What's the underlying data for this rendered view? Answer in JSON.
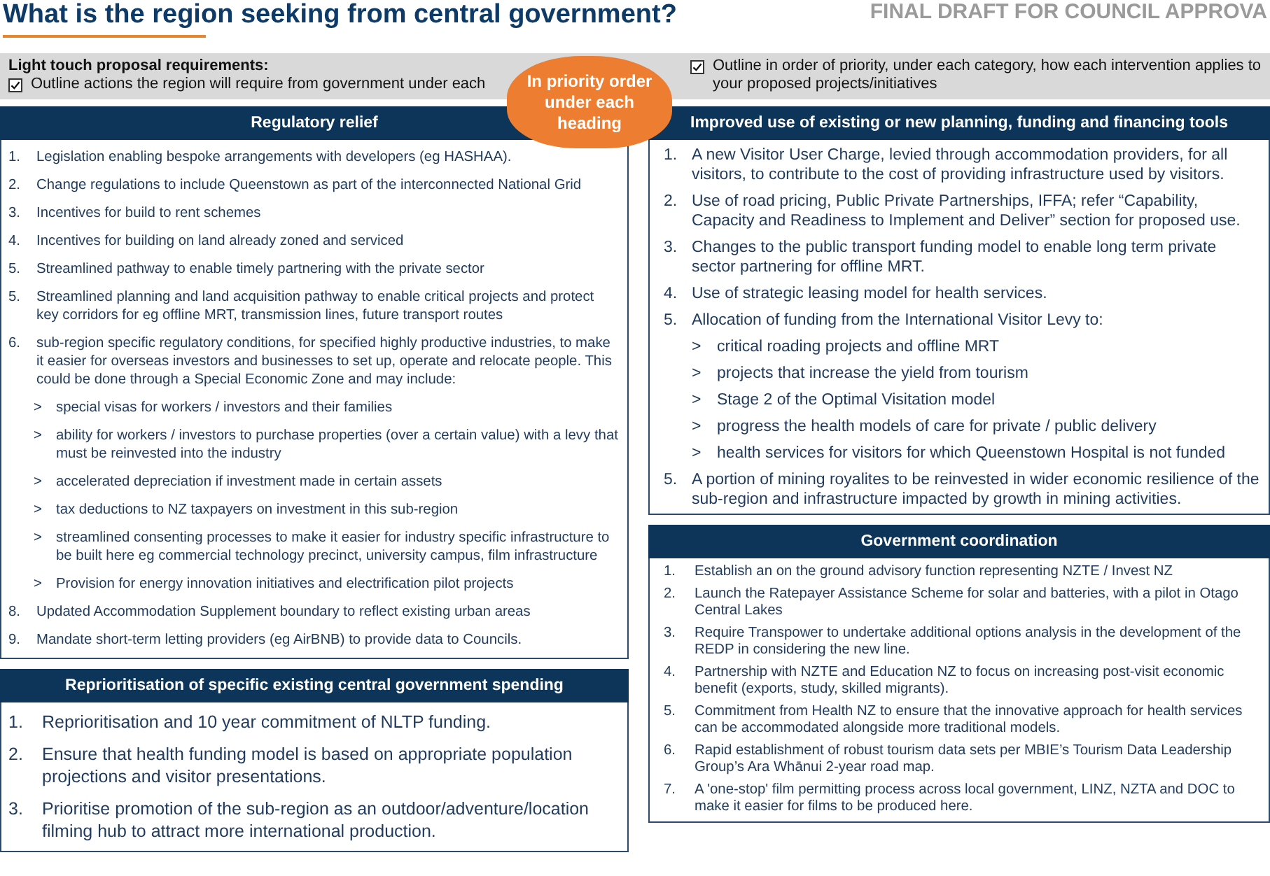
{
  "title": "What is the region seeking from central government?",
  "draft_label": "FINAL DRAFT FOR COUNCIL APPROVA",
  "requirements": {
    "heading": "Light touch proposal requirements:",
    "items": [
      {
        "checked": true,
        "text": "Outline actions the region will require from government under each"
      },
      {
        "checked": true,
        "text": "Outline in order of priority, under each category, how each intervention applies to your proposed projects/initiatives"
      }
    ]
  },
  "callout": "In priority order under each heading",
  "columns": [
    {
      "sections": [
        {
          "heading": "Regulatory relief",
          "items": [
            {
              "number": "1.",
              "text": "Legislation enabling bespoke arrangements with developers (eg HASHAA)."
            },
            {
              "number": "2.",
              "text": "Change regulations to include Queenstown as part of the interconnected National Grid"
            },
            {
              "number": "3.",
              "text": "Incentives for build to rent schemes"
            },
            {
              "number": "4.",
              "text": "Incentives for building on land already zoned and serviced"
            },
            {
              "number": "5.",
              "text": "Streamlined pathway to enable timely partnering with the private sector"
            },
            {
              "number": "5.",
              "text": "Streamlined planning and land acquisition pathway to enable critical projects and protect key corridors for eg offline MRT, transmission lines, future transport routes"
            },
            {
              "number": "6.",
              "text": "sub-region specific regulatory conditions, for specified highly productive industries, to make it easier for overseas investors and businesses to set up, operate and relocate people. This could be done through a Special Economic Zone and may include:",
              "children": [
                {
                  "marker": ">",
                  "text": "special visas for workers / investors and their families"
                },
                {
                  "marker": ">",
                  "text": "ability for workers / investors to purchase properties (over a certain value) with a levy that must be reinvested into the industry"
                },
                {
                  "marker": ">",
                  "text": "accelerated depreciation if investment made in certain assets"
                },
                {
                  "marker": ">",
                  "text": "tax deductions to NZ taxpayers on investment in this sub-region"
                },
                {
                  "marker": ">",
                  "text": "streamlined consenting processes to make it easier for industry specific infrastructure to be built here eg commercial technology precinct, university campus, film infrastructure"
                },
                {
                  "marker": ">",
                  "text": "Provision for energy innovation initiatives and electrification pilot projects"
                }
              ]
            },
            {
              "number": "8.",
              "text": "Updated Accommodation Supplement boundary to reflect existing urban areas"
            },
            {
              "number": "9.",
              "text": "Mandate short-term letting providers (eg AirBNB) to provide data to Councils."
            }
          ]
        },
        {
          "heading": "Reprioritisation of specific existing central government spending",
          "items": [
            {
              "number": "1.",
              "text": "Reprioritisation and 10 year commitment of NLTP funding."
            },
            {
              "number": "2.",
              "text": "Ensure that health funding model is based on appropriate population projections and visitor presentations."
            },
            {
              "number": "3.",
              "text": "Prioritise promotion of the sub-region as an outdoor/adventure/location filming hub to attract more international production."
            }
          ]
        }
      ]
    },
    {
      "sections": [
        {
          "heading": "Improved use of existing or new planning, funding and financing tools",
          "items": [
            {
              "number": "1.",
              "text": "A new Visitor User Charge, levied through accommodation providers, for all visitors, to contribute to the cost of providing infrastructure used by visitors."
            },
            {
              "number": "2.",
              "text": "Use of road pricing, Public Private Partnerships, IFFA; refer “Capability, Capacity and Readiness to Implement and Deliver” section for proposed use."
            },
            {
              "number": "3.",
              "text": "Changes to the public transport funding model to enable long term private sector partnering for offline MRT."
            },
            {
              "number": "4.",
              "text": "Use of strategic leasing model for health services."
            },
            {
              "number": "5.",
              "text": "Allocation of funding from the International Visitor Levy to:",
              "children": [
                {
                  "marker": ">",
                  "text": "critical roading projects and offline MRT"
                },
                {
                  "marker": ">",
                  "text": "projects that increase the yield from tourism"
                },
                {
                  "marker": ">",
                  "text": "Stage 2 of the Optimal Visitation model"
                },
                {
                  "marker": ">",
                  "text": "progress the health models of care for private / public delivery"
                },
                {
                  "marker": ">",
                  "text": "health services for visitors for which Queenstown Hospital is not funded"
                }
              ]
            },
            {
              "number": "5.",
              "text": "A portion of mining royalites to be reinvested in wider economic resilience of the sub-region and infrastructure impacted by growth in mining activities."
            }
          ]
        },
        {
          "heading": "Government coordination",
          "items": [
            {
              "number": "1.",
              "text": "Establish an on the ground advisory function representing NZTE / Invest NZ"
            },
            {
              "number": "2.",
              "text": "Launch the Ratepayer Assistance Scheme for solar and batteries, with a pilot in Otago Central Lakes"
            },
            {
              "number": "3.",
              "text": "Require Transpower to undertake additional options analysis in the development of the REDP in considering the new line."
            },
            {
              "number": "4.",
              "text": "Partnership with NZTE and Education NZ to focus on increasing post-visit economic benefit (exports, study, skilled migrants)."
            },
            {
              "number": "5.",
              "text": "Commitment from Health NZ to ensure that the innovative approach for health services can be accommodated alongside more traditional models."
            },
            {
              "number": "6.",
              "text": "Rapid establishment of robust tourism data sets per MBIE’s Tourism Data Leadership Group’s Ara Whānui 2-year road map."
            },
            {
              "number": "7.",
              "text": "A 'one-stop' film permitting process across local government, LINZ, NZTA and DOC to make it easier for films to be produced here."
            }
          ]
        }
      ]
    }
  ]
}
